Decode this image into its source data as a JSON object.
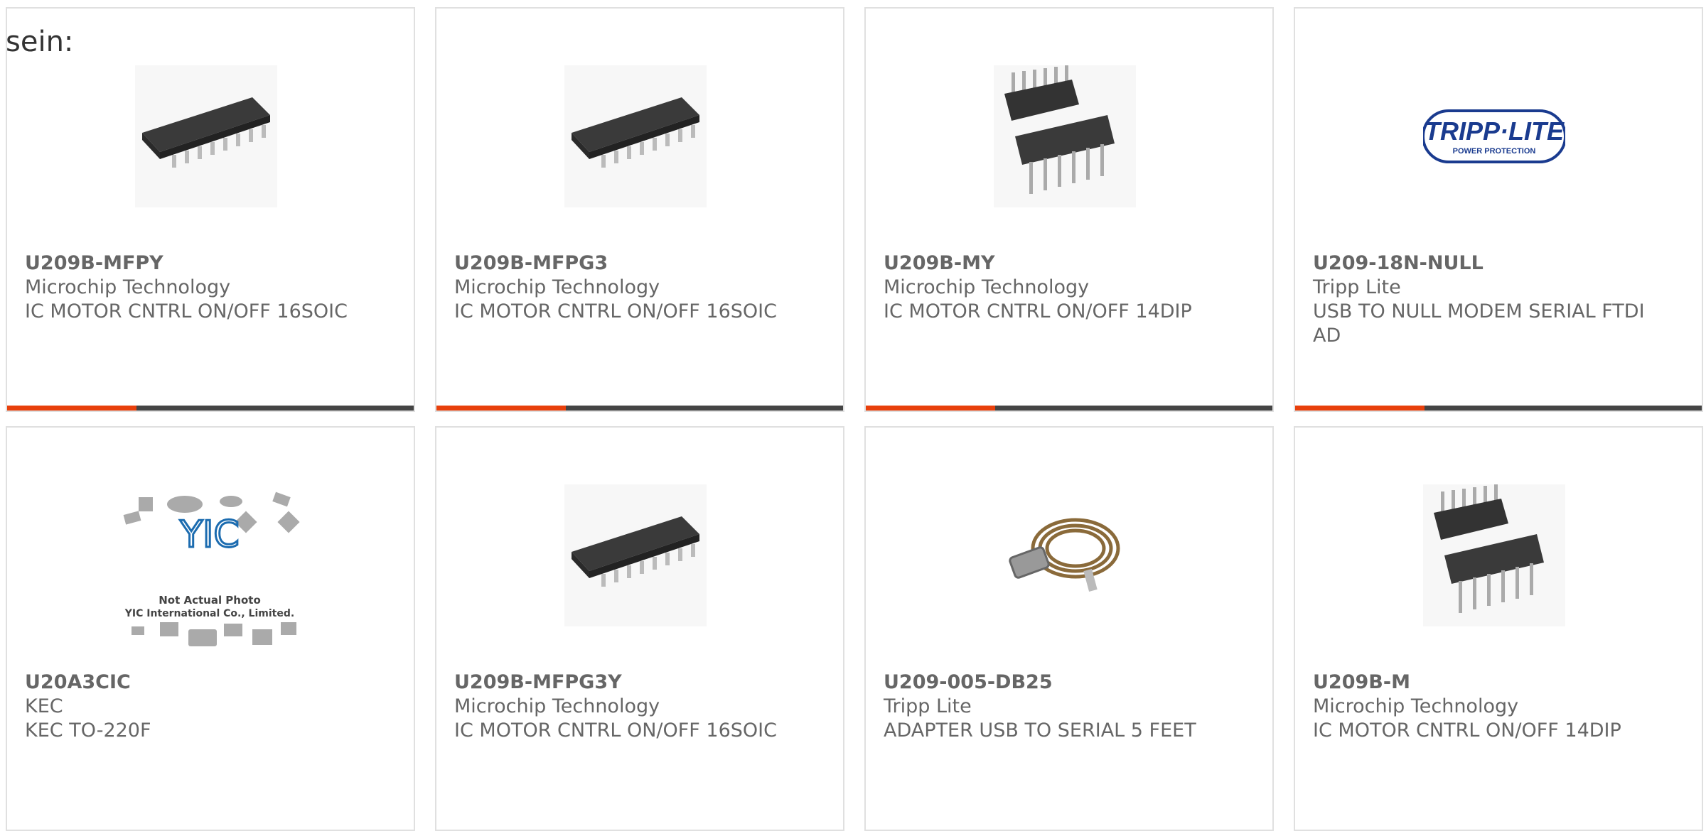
{
  "intro_text": "sein:",
  "accent_color": "#e8400c",
  "bar_color": "#444444",
  "products": [
    {
      "part": "U209B-MFPY",
      "maker": "Microchip Technology",
      "desc": "IC MOTOR CNTRL ON/OFF 16SOIC",
      "image": "soic-chip-icon"
    },
    {
      "part": "U209B-MFPG3",
      "maker": "Microchip Technology",
      "desc": "IC MOTOR CNTRL ON/OFF 16SOIC",
      "image": "soic-chip-icon"
    },
    {
      "part": "U209B-MY",
      "maker": "Microchip Technology",
      "desc": "IC MOTOR CNTRL ON/OFF 14DIP",
      "image": "dip-chip-icon"
    },
    {
      "part": "U209-18N-NULL",
      "maker": "Tripp Lite",
      "desc": "USB TO NULL MODEM SERIAL FTDI AD",
      "image": "tripp-lite-logo",
      "logo_text": "TRIPP·LITE",
      "logo_sub": "POWER PROTECTION"
    },
    {
      "part": "U20A3CIC",
      "maker": "KEC",
      "desc": "KEC TO-220F",
      "image": "placeholder-photo",
      "ph_line1": "Not Actual Photo",
      "ph_line2": "YIC International Co., Limited."
    },
    {
      "part": "U209B-MFPG3Y",
      "maker": "Microchip Technology",
      "desc": "IC MOTOR CNTRL ON/OFF 16SOIC",
      "image": "soic-chip-icon"
    },
    {
      "part": "U209-005-DB25",
      "maker": "Tripp Lite",
      "desc": "ADAPTER USB TO SERIAL 5 FEET",
      "image": "usb-serial-cable-icon"
    },
    {
      "part": "U209B-M",
      "maker": "Microchip Technology",
      "desc": "IC MOTOR CNTRL ON/OFF 14DIP",
      "image": "dip-chip-icon"
    }
  ]
}
